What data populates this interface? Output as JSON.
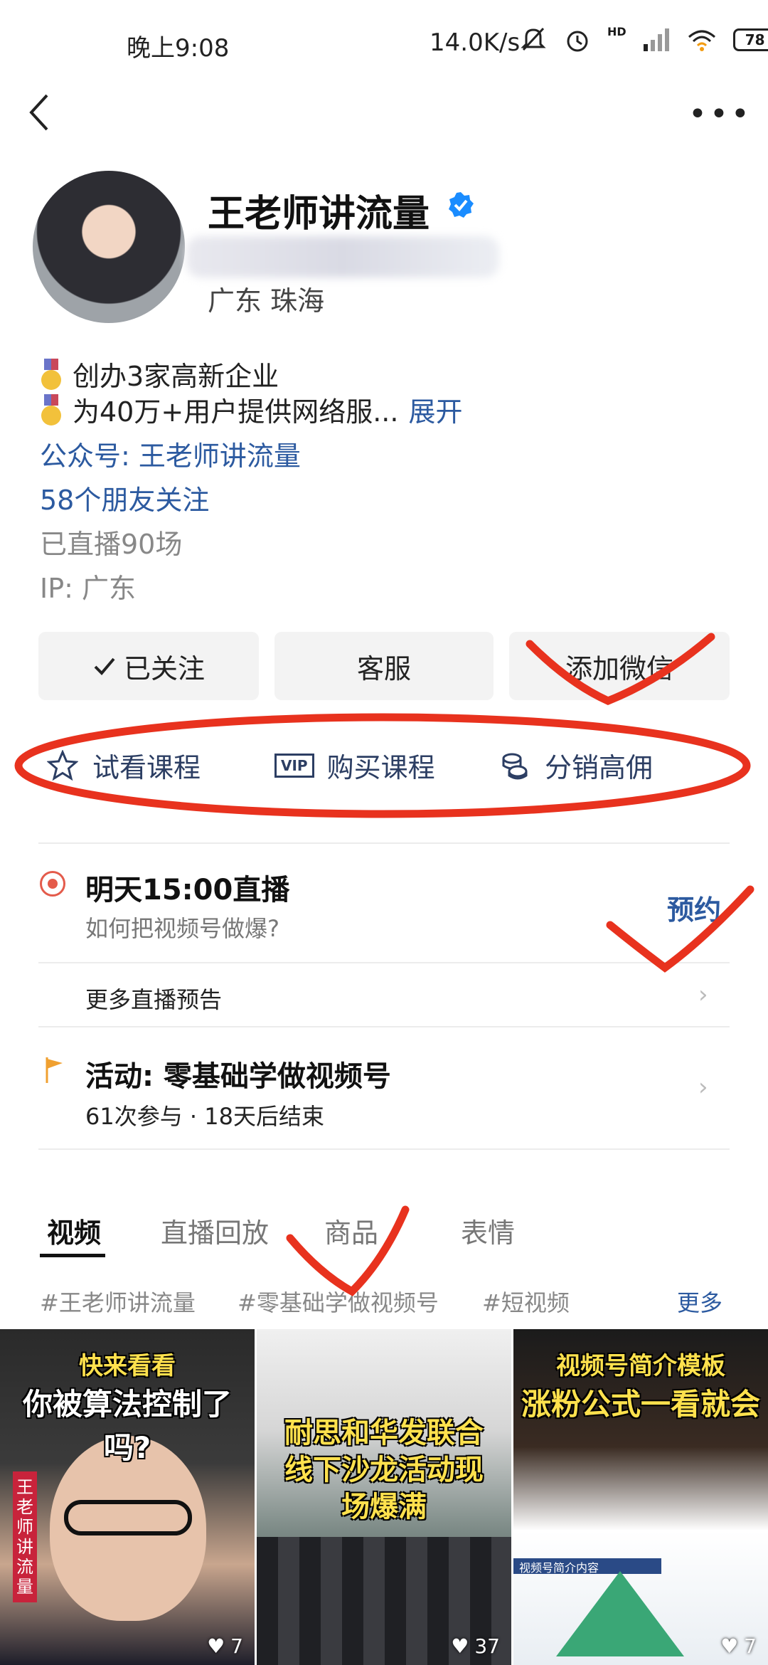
{
  "status_bar": {
    "time": "晚上9:08",
    "net_speed": "14.0K/s",
    "battery": "78",
    "hd": "HD"
  },
  "profile": {
    "name": "王老师讲流量",
    "location": "广东 珠海",
    "bio": [
      {
        "text": "创办3家高新企业"
      },
      {
        "text": "为40万+用户提供网络服..."
      }
    ],
    "expand_label": "展开",
    "official_account": "公众号: 王老师讲流量",
    "friends_follow": "58个朋友关注",
    "live_count": "已直播90场",
    "ip": "IP: 广东"
  },
  "actions": {
    "follow": "已关注",
    "service": "客服",
    "add_wechat": "添加微信"
  },
  "features": {
    "trial": "试看课程",
    "vip_icon": "VIP",
    "buy": "购买课程",
    "commission": "分销高佣"
  },
  "live": {
    "title": "明天15:00直播",
    "subtitle": "如何把视频号做爆?",
    "reserve": "预约",
    "more_label": "更多直播预告"
  },
  "activity": {
    "title": "活动: 零基础学做视频号",
    "meta": "61次参与 · 18天后结束"
  },
  "tabs": [
    {
      "label": "视频"
    },
    {
      "label": "直播回放"
    },
    {
      "label": "商品"
    },
    {
      "label": "表情"
    }
  ],
  "tags": [
    {
      "label": "#王老师讲流量"
    },
    {
      "label": "#零基础学做视频号"
    },
    {
      "label": "#短视频"
    }
  ],
  "tags_more": "更多",
  "videos": [
    {
      "caption_top": "快来看看",
      "caption_main": "你被算法控制了吗?",
      "side_label": "王老师讲流量",
      "likes": "7"
    },
    {
      "caption_main": "耐思和华发联合线下沙龙活动现场爆满",
      "likes": "37"
    },
    {
      "caption_top": "视频号简介模板",
      "caption_main": "涨粉公式一看就会",
      "slide_title": "视频号简介内容",
      "likes": "7"
    }
  ],
  "colors": {
    "link": "#2c5aa0",
    "annotation_red": "#e8321e",
    "live_red": "#e45b4b"
  }
}
